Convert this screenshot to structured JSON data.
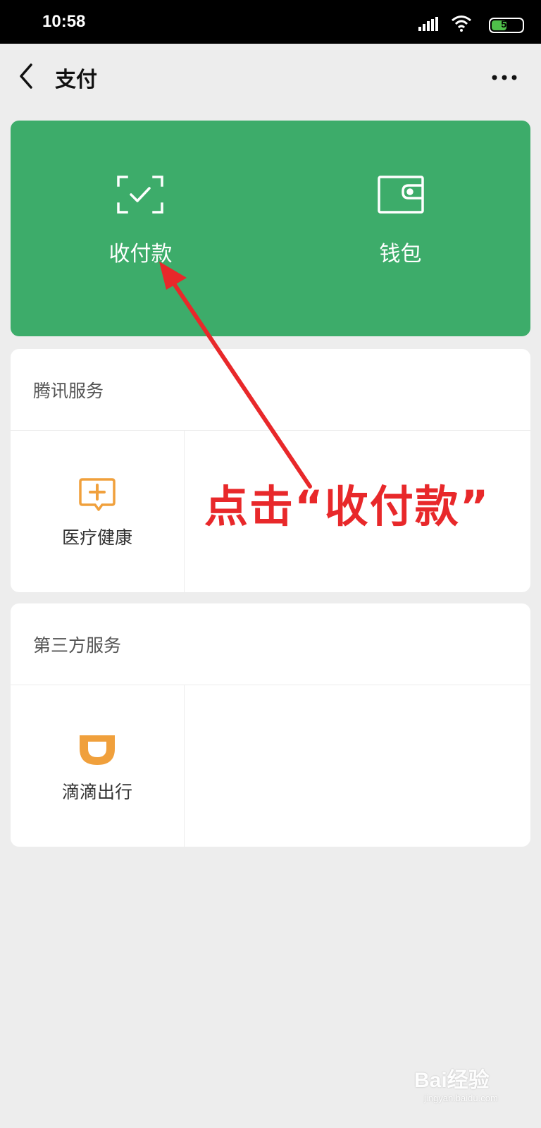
{
  "status_bar": {
    "time": "10:58",
    "battery": "54",
    "battery_level": 0.54
  },
  "nav": {
    "title": "支付"
  },
  "top_card": {
    "items": [
      {
        "label": "收付款",
        "icon": "scan-check-icon"
      },
      {
        "label": "钱包",
        "icon": "wallet-icon"
      }
    ]
  },
  "tencent_services": {
    "title": "腾讯服务",
    "items": [
      {
        "label": "医疗健康",
        "icon": "medical-chat-icon"
      }
    ]
  },
  "third_party_services": {
    "title": "第三方服务",
    "items": [
      {
        "label": "滴滴出行",
        "icon": "didi-icon"
      }
    ]
  },
  "annotation": {
    "text": "点击“收付款”"
  },
  "watermark": {
    "logo_text": "Bai经验",
    "url": "jingyan.baidu.com"
  },
  "colors": {
    "accent_green": "#3dac6a",
    "annotation_red": "#e8282a",
    "service_orange": "#f0a03c",
    "background": "#ededed"
  }
}
